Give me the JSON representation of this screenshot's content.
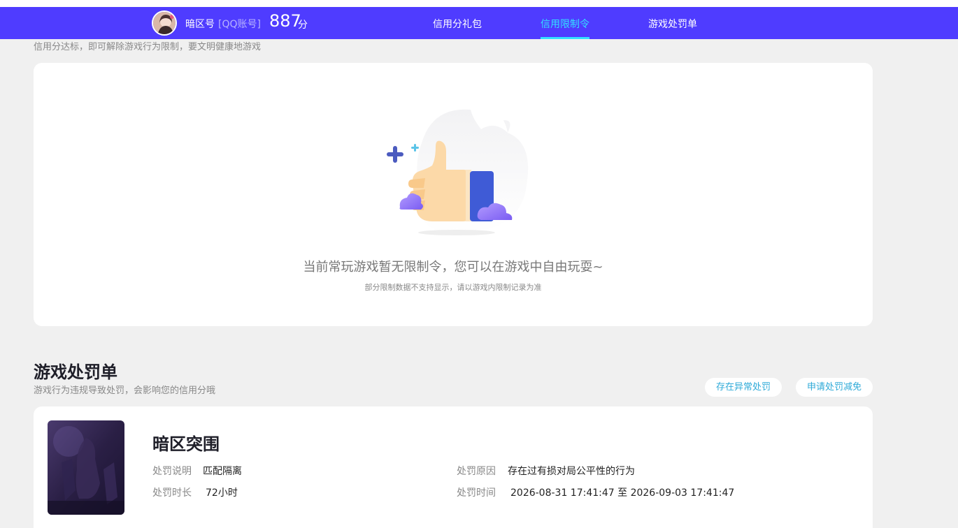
{
  "header": {
    "username": "暗区号",
    "account_type": "[QQ账号]",
    "score": "887",
    "score_unit": "分",
    "tabs": [
      {
        "label": "信用分礼包"
      },
      {
        "label": "信用限制令"
      },
      {
        "label": "游戏处罚单"
      }
    ],
    "active_tab": "信用限制令"
  },
  "restriction": {
    "subtitle": "信用分达标，即可解除游戏行为限制，要文明健康地游戏",
    "empty_message": "当前常玩游戏暂无限制令，您可以在游戏中自由玩耍~",
    "empty_note": "部分限制数据不支持显示，请以游戏内限制记录为准"
  },
  "penalty": {
    "title": "游戏处罚单",
    "description": "游戏行为违规导致处罚，会影响您的信用分哦",
    "buttons": {
      "abnormal": "存在异常处罚",
      "reduce": "申请处罚减免"
    },
    "record": {
      "game": "暗区突围",
      "fields": {
        "desc_label": "处罚说明",
        "desc_value": "匹配隔离",
        "duration_label": "处罚时长",
        "duration_value": "72小时",
        "reason_label": "处罚原因",
        "reason_value": "存在过有损对局公平性的行为",
        "time_label": "处罚时间",
        "time_value": "2026-08-31 17:41:47 至 2026-09-03 17:41:47"
      }
    }
  },
  "colors": {
    "nav_bg": "#4f3cff",
    "accent": "#33e0ff",
    "link": "#2eaad8",
    "page_bg": "#f0f0f0"
  }
}
